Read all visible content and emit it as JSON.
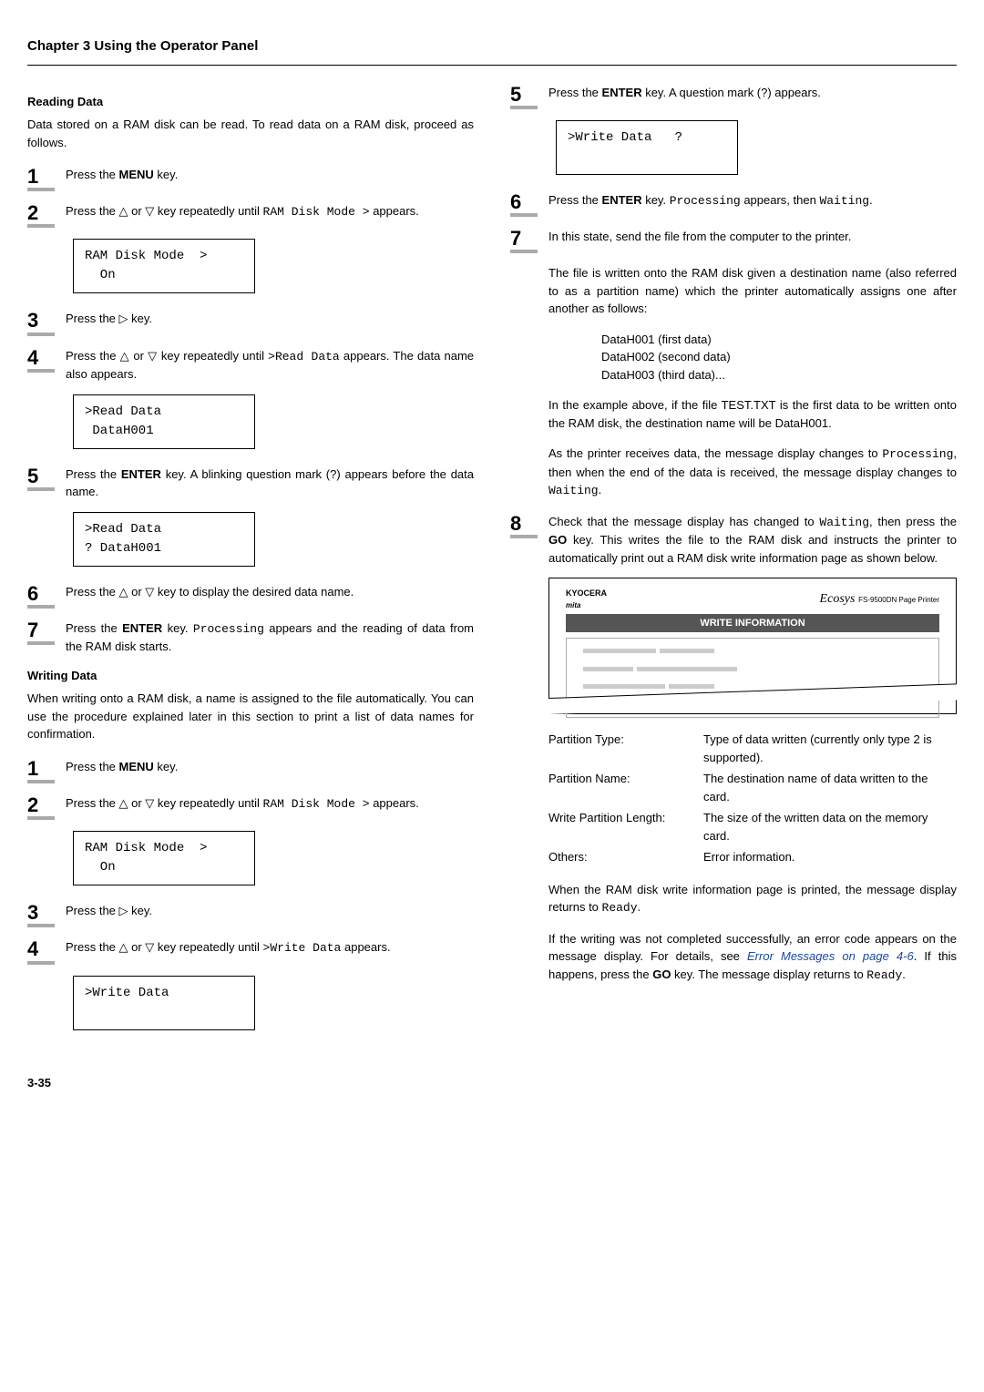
{
  "header": "Chapter 3  Using the Operator Panel",
  "left": {
    "reading": {
      "title": "Reading Data",
      "intro": "Data stored on a RAM disk can be read. To read data on a RAM disk, proceed as follows.",
      "s1_a": "Press the ",
      "s1_b": "MENU",
      "s1_c": " key.",
      "s2_a": "Press the △ or ▽ key repeatedly until ",
      "s2_mono": "RAM Disk Mode >",
      "s2_c": " appears.",
      "box1": "RAM Disk Mode  >\n  On",
      "s3": "Press the ▷ key.",
      "s4_a": "Press the △ or ▽ key repeatedly until ",
      "s4_mono": ">Read Data",
      "s4_c": " appears. The data name also appears.",
      "box2": ">Read Data\n DataH001",
      "s5_a": "Press the ",
      "s5_b": "ENTER",
      "s5_c": " key. A blinking question mark (?) appears before the data name.",
      "box3": ">Read Data\n? DataH001",
      "s6": "Press the △ or ▽ key to display the desired data name.",
      "s7_a": "Press the ",
      "s7_b": "ENTER",
      "s7_c": " key. ",
      "s7_mono": "Processing",
      "s7_d": " appears and the reading of data from the RAM disk starts."
    },
    "writing": {
      "title": "Writing Data",
      "intro": "When writing onto a RAM disk, a name is assigned to the file automatically. You can use the procedure explained later in this section to print a list of data names for confirmation.",
      "s1_a": "Press the ",
      "s1_b": "MENU",
      "s1_c": " key.",
      "s2_a": "Press the △ or ▽ key repeatedly until ",
      "s2_mono": "RAM Disk Mode >",
      "s2_c": " appears.",
      "box1": "RAM Disk Mode  >\n  On",
      "s3": "Press the ▷ key.",
      "s4_a": "Press the △ or ▽ key repeatedly until ",
      "s4_mono": ">Write Data",
      "s4_c": " appears.",
      "box2": ">Write Data\n "
    }
  },
  "right": {
    "s5_a": "Press the ",
    "s5_b": "ENTER",
    "s5_c": " key. A question mark (?) appears.",
    "box5": ">Write Data   ?\n ",
    "s6_a": "Press the ",
    "s6_b": "ENTER",
    "s6_c": " key. ",
    "s6_mono1": "Processing",
    "s6_d": " appears, then ",
    "s6_mono2": "Waiting",
    "s6_e": ".",
    "s7": "In this state, send the file from the computer to the printer.",
    "p1": "The file is written onto the RAM disk given a destination name (also referred to as a partition name) which the printer automatically assigns one after another as follows:",
    "d1": "DataH001 (first data)",
    "d2": "DataH002 (second data)",
    "d3": "DataH003 (third data)...",
    "p2": "In the example above, if the file TEST.TXT is the first data to be written onto the RAM disk, the destination name will be DataH001.",
    "p3_a": "As the printer receives data, the message display changes to ",
    "p3_m1": "Processing",
    "p3_b": ", then when the end of the data is received, the message display changes to ",
    "p3_m2": "Waiting",
    "p3_c": ".",
    "s8_a": "Check that the message display has changed to ",
    "s8_m": "Waiting",
    "s8_b": ", then press the ",
    "s8_go": "GO",
    "s8_c": " key. This writes the file to the RAM disk and instructs the printer to automatically print out a RAM disk write information page as shown below.",
    "infopage": {
      "logo": "KYOCERA",
      "sublogo": "mita",
      "ecosys": "Ecosys",
      "model": "FS-9500DN Page Printer",
      "title": "WRITE INFORMATION"
    },
    "defs": {
      "r1k": "Partition Type:",
      "r1v": "Type of data written (currently only type 2 is supported).",
      "r2k": "Partition Name:",
      "r2v": "The destination name of data written to the card.",
      "r3k": "Write Partition Length:",
      "r3v": "The size of the written data on the memory card.",
      "r4k": "Others:",
      "r4v": "Error information."
    },
    "p4_a": "When the RAM disk write information page is printed, the message display returns to ",
    "p4_m": "Ready",
    "p4_b": ".",
    "p5_a": "If the writing was not completed successfully, an error code appears on the message display. For details, see ",
    "p5_link": "Error Messages on page 4-6",
    "p5_b": ". If this happens, press the ",
    "p5_go": "GO",
    "p5_c": " key. The message display returns to ",
    "p5_m": "Ready",
    "p5_d": "."
  },
  "pagenum": "3-35"
}
